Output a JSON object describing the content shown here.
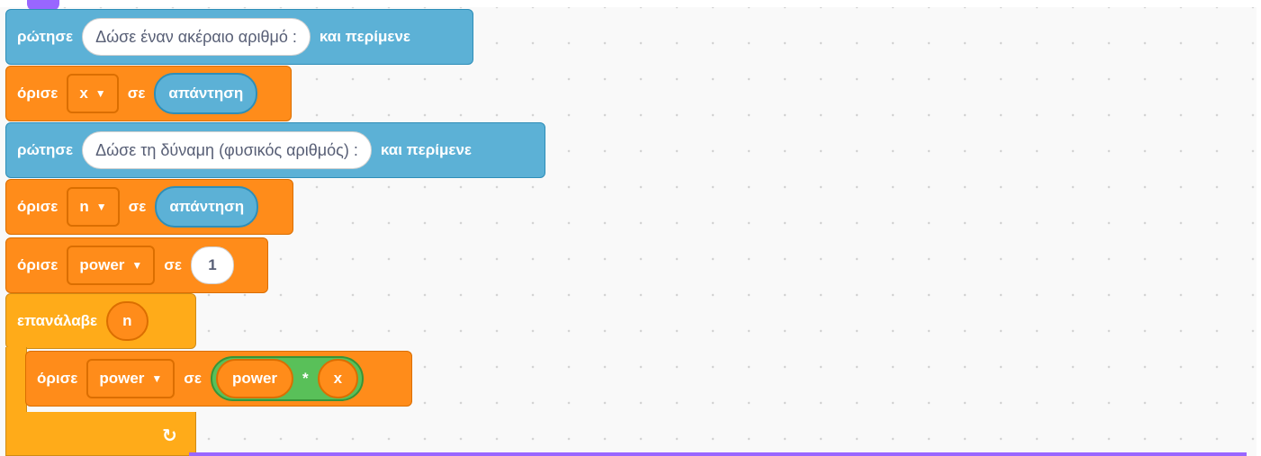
{
  "blocks": {
    "ask1": {
      "keyword": "ρώτησε",
      "question": "Δώσε έναν ακέραιο αριθμό :",
      "suffix": "και περίμενε"
    },
    "set1": {
      "keyword": "όρισε",
      "variable": "x",
      "to": "σε",
      "value": "απάντηση"
    },
    "ask2": {
      "keyword": "ρώτησε",
      "question": "Δώσε τη δύναμη (φυσικός αριθμός) :",
      "suffix": "και περίμενε"
    },
    "set2": {
      "keyword": "όρισε",
      "variable": "n",
      "to": "σε",
      "value": "απάντηση"
    },
    "set3": {
      "keyword": "όρισε",
      "variable": "power",
      "to": "σε",
      "value": "1"
    },
    "repeat": {
      "keyword": "επανάλαβε",
      "times": "n",
      "loop_icon": "loop-arrow-icon"
    },
    "set4": {
      "keyword": "όρισε",
      "variable": "power",
      "to": "σε",
      "left": "power",
      "operator": "*",
      "right": "x"
    }
  },
  "icons": {
    "dropdown": "caret-down-icon",
    "loop": "loop-arrow-icon"
  },
  "colors": {
    "sensing": "#5cb1d6",
    "variables": "#ff8c1a",
    "control": "#ffab19",
    "operators": "#59c059",
    "events": "#9966ff"
  }
}
